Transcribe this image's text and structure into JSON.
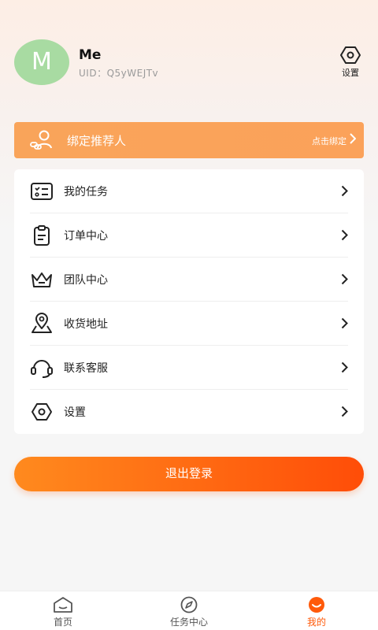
{
  "profile": {
    "avatar_letter": "M",
    "name": "Me",
    "uid": "UID：Q5yWEJTv",
    "settings_label": "设置"
  },
  "bind_referrer": {
    "title": "绑定推荐人",
    "action": "点击绑定"
  },
  "menu": {
    "items": [
      {
        "label": "我的任务",
        "icon": "task-list-icon"
      },
      {
        "label": "订单中心",
        "icon": "clipboard-icon"
      },
      {
        "label": "团队中心",
        "icon": "crown-icon"
      },
      {
        "label": "收货地址",
        "icon": "location-pin-icon"
      },
      {
        "label": "联系客服",
        "icon": "headset-icon"
      },
      {
        "label": "设置",
        "icon": "hexagon-settings-icon"
      }
    ]
  },
  "logout_label": "退出登录",
  "tabbar": {
    "tabs": [
      {
        "label": "首页",
        "icon": "home-icon"
      },
      {
        "label": "任务中心",
        "icon": "compass-icon"
      },
      {
        "label": "我的",
        "icon": "smile-icon",
        "active": true
      }
    ]
  },
  "colors": {
    "accent": "#ff5a0a",
    "bind_bar": "#f9a45a",
    "avatar_bg": "#a8dba2"
  }
}
